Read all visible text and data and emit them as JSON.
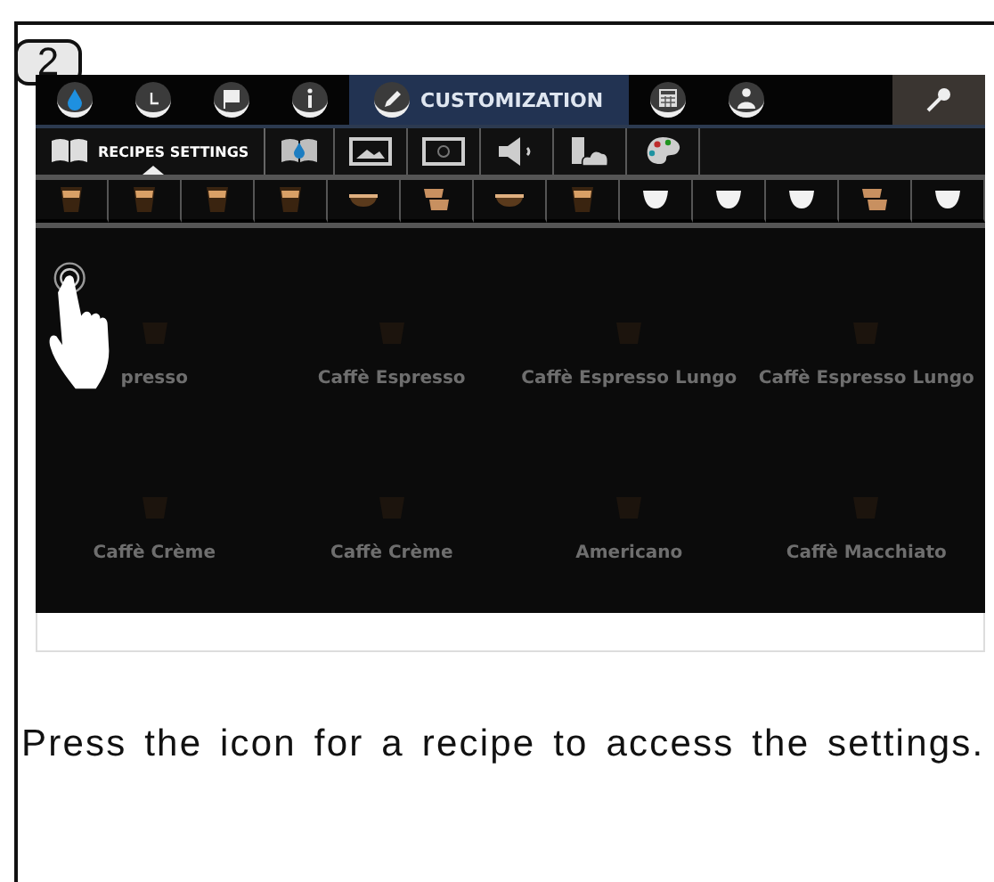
{
  "step": "2",
  "top_tabs": [
    {
      "kind": "drop",
      "selected": false
    },
    {
      "kind": "clock",
      "selected": false
    },
    {
      "kind": "flag",
      "selected": false
    },
    {
      "kind": "info",
      "selected": false
    },
    {
      "kind": "pencil",
      "label": "CUSTOMIZATION",
      "selected": true
    },
    {
      "kind": "calculator",
      "selected": false
    },
    {
      "kind": "person",
      "selected": false
    }
  ],
  "sub_tabs": [
    {
      "kind": "book",
      "label": "RECIPES SETTINGS",
      "selected": true
    },
    {
      "kind": "book-drop",
      "selected": false
    },
    {
      "kind": "picture",
      "selected": false
    },
    {
      "kind": "frame",
      "selected": false
    },
    {
      "kind": "speaker",
      "selected": false
    },
    {
      "kind": "usb-cloud",
      "selected": false
    },
    {
      "kind": "palette",
      "selected": false
    }
  ],
  "recipe_strip": [
    {
      "kind": "glass"
    },
    {
      "kind": "glass"
    },
    {
      "kind": "glass"
    },
    {
      "kind": "glass"
    },
    {
      "kind": "bowl"
    },
    {
      "kind": "stack"
    },
    {
      "kind": "bowl"
    },
    {
      "kind": "glass"
    },
    {
      "kind": "cup"
    },
    {
      "kind": "cup"
    },
    {
      "kind": "cup"
    },
    {
      "kind": "stack"
    },
    {
      "kind": "cup"
    }
  ],
  "recipes": [
    {
      "label": "presso"
    },
    {
      "label": "Caffè Espresso"
    },
    {
      "label": "Caffè Espresso Lungo"
    },
    {
      "label": "Caffè Espresso Lungo"
    },
    {
      "label": "Caffè Crème"
    },
    {
      "label": "Caffè Crème"
    },
    {
      "label": "Americano"
    },
    {
      "label": "Caffè Macchiato"
    }
  ],
  "instruction": "Press the icon for a recipe to access the settings."
}
